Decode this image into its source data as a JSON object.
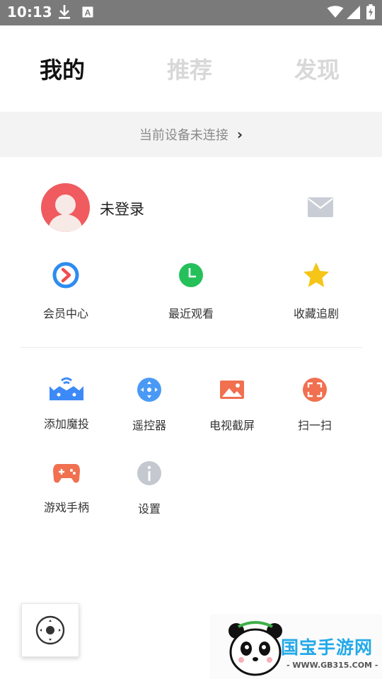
{
  "status_bar": {
    "time": "10:13",
    "icons": [
      "download-icon",
      "a-box-icon",
      "wifi-icon",
      "signal-icon",
      "battery-charging-icon"
    ]
  },
  "top_tabs": [
    {
      "label": "我的",
      "active": true
    },
    {
      "label": "推荐",
      "active": false
    },
    {
      "label": "发现",
      "active": false
    }
  ],
  "device_bar": {
    "label": "当前设备未连接",
    "icon": "chevron-right-icon"
  },
  "profile": {
    "status": "未登录",
    "avatar": "default-avatar",
    "message_icon": "mail-icon"
  },
  "quick_actions": [
    {
      "label": "会员中心",
      "icon": "vip-play-icon",
      "color": "#2d8cf0"
    },
    {
      "label": "最近观看",
      "icon": "clock-icon",
      "color": "#25c05a"
    },
    {
      "label": "收藏追剧",
      "icon": "star-icon",
      "color": "#f5c518"
    }
  ],
  "tools": [
    {
      "label": "添加魔投",
      "icon": "tv-box-icon",
      "color": "#3d8af7"
    },
    {
      "label": "遥控器",
      "icon": "remote-dpad-icon",
      "color": "#4a9af5"
    },
    {
      "label": "电视截屏",
      "icon": "image-icon",
      "color": "#f07050"
    },
    {
      "label": "扫一扫",
      "icon": "scan-icon",
      "color": "#f07050"
    },
    {
      "label": "游戏手柄",
      "icon": "gamepad-icon",
      "color": "#f07050"
    },
    {
      "label": "设置",
      "icon": "info-icon",
      "color": "#c4c8cf"
    }
  ],
  "floating_button": {
    "icon": "remote-control-icon"
  },
  "watermark": {
    "title": "国宝手游网",
    "url": "- WWW.GB315.COM -"
  }
}
